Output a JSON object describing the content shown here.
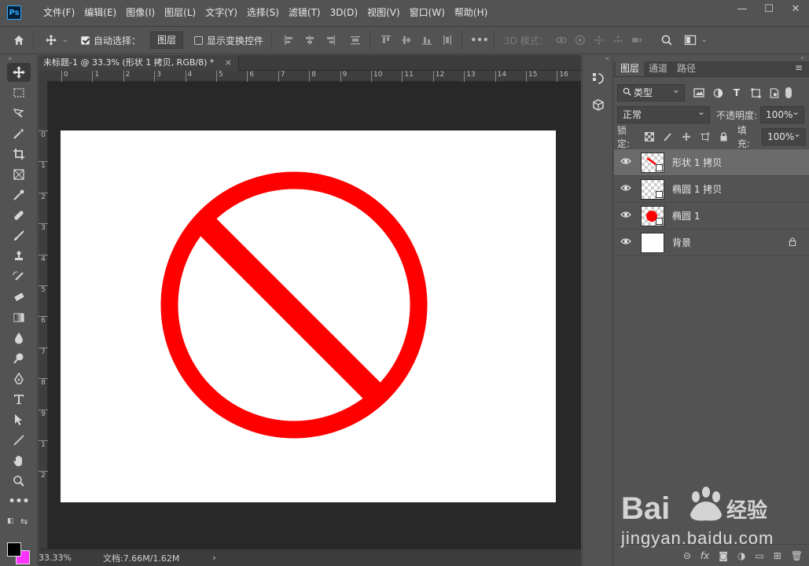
{
  "app": {
    "logo_text": "Ps"
  },
  "menu": [
    "文件(F)",
    "编辑(E)",
    "图像(I)",
    "图层(L)",
    "文字(Y)",
    "选择(S)",
    "滤镜(T)",
    "3D(D)",
    "视图(V)",
    "窗口(W)",
    "帮助(H)"
  ],
  "window_controls": {
    "minimize": "—",
    "maximize": "☐",
    "close": "✕"
  },
  "options": {
    "auto_select_label": "自动选择：",
    "auto_select_checked": true,
    "auto_select_target": "图层",
    "show_transform_label": "显示变换控件",
    "show_transform_checked": false,
    "more": "•••",
    "mode_3d_label": "3D 模式："
  },
  "document": {
    "tab_title": "未标题-1 @ 33.3% (形状 1 拷贝, RGB/8) *",
    "tab_close": "×",
    "ruler_h_ticks": [
      "0",
      "1",
      "2",
      "3",
      "4",
      "5",
      "6",
      "7",
      "8",
      "9",
      "10",
      "11",
      "12",
      "13",
      "14",
      "15",
      "16"
    ],
    "ruler_v_ticks": [
      "0",
      "1",
      "2",
      "3",
      "4",
      "5",
      "6",
      "7",
      "8",
      "9",
      "1",
      "2"
    ],
    "canvas_bg": "#ffffff",
    "shape_color": "#ff0000"
  },
  "status": {
    "zoom": "33.33%",
    "doc_info": "文档:7.66M/1.62M",
    "arrow": "›"
  },
  "layers_panel": {
    "tabs": [
      "图层",
      "通道",
      "路径"
    ],
    "active_tab": "图层",
    "filter_label": "类型",
    "blend_mode": "正常",
    "opacity_label": "不透明度:",
    "opacity_value": "100%",
    "lock_label": "锁定:",
    "fill_label": "填充:",
    "fill_value": "100%",
    "layers": [
      {
        "name": "形状 1 拷贝",
        "selected": true
      },
      {
        "name": "椭圆 1 拷贝",
        "selected": false
      },
      {
        "name": "椭圆 1",
        "selected": false
      },
      {
        "name": "背景",
        "selected": false,
        "locked": true
      }
    ],
    "footer_fx": "fx"
  },
  "colors": {
    "foreground": "#000000",
    "background": "#ff33ff"
  },
  "watermark": {
    "brand": "Bai",
    "brand_suffix": "经验",
    "url": "jingyan.baidu.com"
  }
}
